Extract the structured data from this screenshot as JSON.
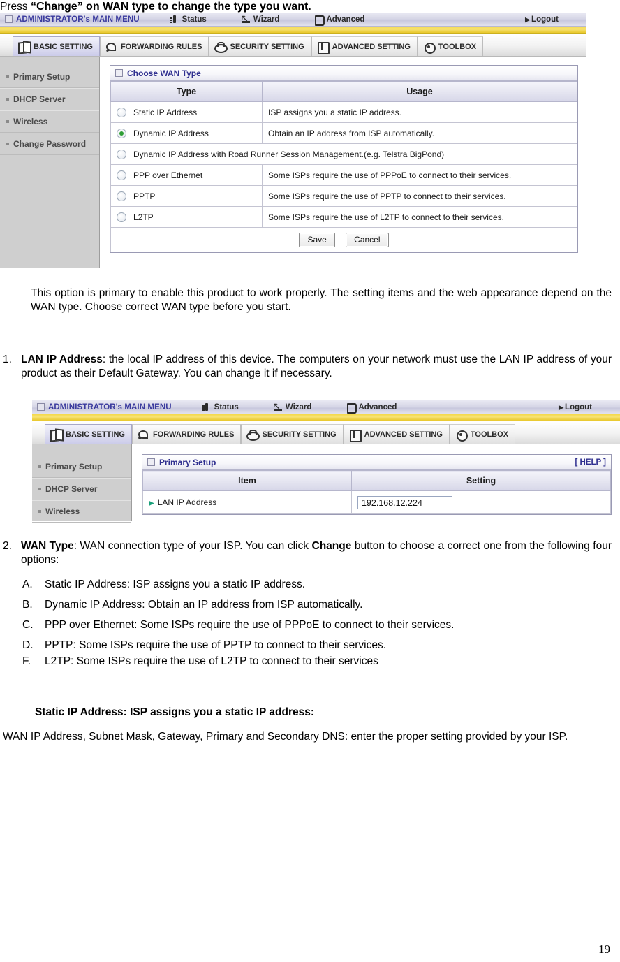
{
  "document": {
    "intro_line": "Press “Change” on WAN type to change the type you want.",
    "page_number": "19",
    "paragraph_wan_note": "This option is primary to enable this product to work properly. The setting items and the web appearance depend on the WAN type. Choose correct WAN type before you start.",
    "items": [
      {
        "marker": "1.",
        "term": "LAN IP Address",
        "body": ": the local IP address of this device. The computers on your network must use the LAN IP address of your product as their Default Gateway. You can change it if necessary."
      },
      {
        "marker": "2.",
        "term": "WAN Type",
        "body_part1": ": WAN connection type of your ISP. You can click ",
        "emphasis": "Change",
        "body_part2": " button to choose a correct one from the following four options:"
      }
    ],
    "sub_items": [
      {
        "marker": "A.",
        "text": "Static IP Address: ISP assigns you a static IP address."
      },
      {
        "marker": "B.",
        "text": "Dynamic IP Address: Obtain an IP address from ISP automatically."
      },
      {
        "marker": "C.",
        "text": "PPP over Ethernet: Some ISPs require the use of   PPPoE to connect to their services."
      },
      {
        "marker": "D.",
        "text": "PPTP: Some ISPs require the use of   PPTP to connect to their services."
      },
      {
        "marker": "F.",
        "text": "L2TP: Some ISPs require the use of   L2TP to connect to their services"
      }
    ],
    "static_heading": "Static IP Address: ISP assigns you a static IP address:",
    "static_body": "WAN IP Address, Subnet Mask, Gateway, Primary and Secondary DNS: enter the proper setting provided by your ISP."
  },
  "router_ui": {
    "topbar": {
      "main_menu": "ADMINISTRATOR's MAIN MENU",
      "status": "Status",
      "wizard": "Wizard",
      "advanced": "Advanced",
      "logout": "Logout"
    },
    "tabs": [
      {
        "label": "BASIC SETTING",
        "icon": "book-icon",
        "active": true
      },
      {
        "label": "FORWARDING RULES",
        "icon": "pencil-icon",
        "active": false
      },
      {
        "label": "SECURITY SETTING",
        "icon": "shield-icon",
        "active": false
      },
      {
        "label": "ADVANCED SETTING",
        "icon": "cabinet-icon",
        "active": false
      },
      {
        "label": "TOOLBOX",
        "icon": "gear-icon",
        "active": false
      }
    ],
    "sidebar_full": [
      "Primary Setup",
      "DHCP Server",
      "Wireless",
      "Change Password"
    ],
    "sidebar_partial": [
      "Primary Setup",
      "DHCP Server",
      "Wireless"
    ],
    "colors": {
      "topbar_text": "#3b3b9e",
      "stripe": "#f3d94a",
      "panel_title_text": "#2f2f8f",
      "sidebar_bg": "#cfcfcf",
      "radio_selected": "#2f9e35"
    }
  },
  "wan_panel": {
    "title": "Choose WAN Type",
    "columns": [
      "Type",
      "Usage"
    ],
    "rows": [
      {
        "type": "Static IP Address",
        "usage": "ISP assigns you a static IP address.",
        "selected": false,
        "span": false
      },
      {
        "type": "Dynamic IP Address",
        "usage": "Obtain an IP address from ISP automatically.",
        "selected": true,
        "span": false
      },
      {
        "type": "Dynamic IP Address with Road Runner Session Management.(e.g. Telstra BigPond)",
        "usage": "",
        "selected": false,
        "span": true
      },
      {
        "type": "PPP over Ethernet",
        "usage": "Some ISPs require the use of PPPoE to connect to their services.",
        "selected": false,
        "span": false
      },
      {
        "type": "PPTP",
        "usage": "Some ISPs require the use of PPTP to connect to their services.",
        "selected": false,
        "span": false
      },
      {
        "type": "L2TP",
        "usage": "Some ISPs require the use of L2TP to connect to their services.",
        "selected": false,
        "span": false
      }
    ],
    "save_label": "Save",
    "cancel_label": "Cancel"
  },
  "primary_setup_panel": {
    "title": "Primary Setup",
    "help_label": "[ HELP ]",
    "columns": [
      "Item",
      "Setting"
    ],
    "rows": [
      {
        "item": "LAN IP Address",
        "value": "192.168.12.224"
      }
    ]
  }
}
